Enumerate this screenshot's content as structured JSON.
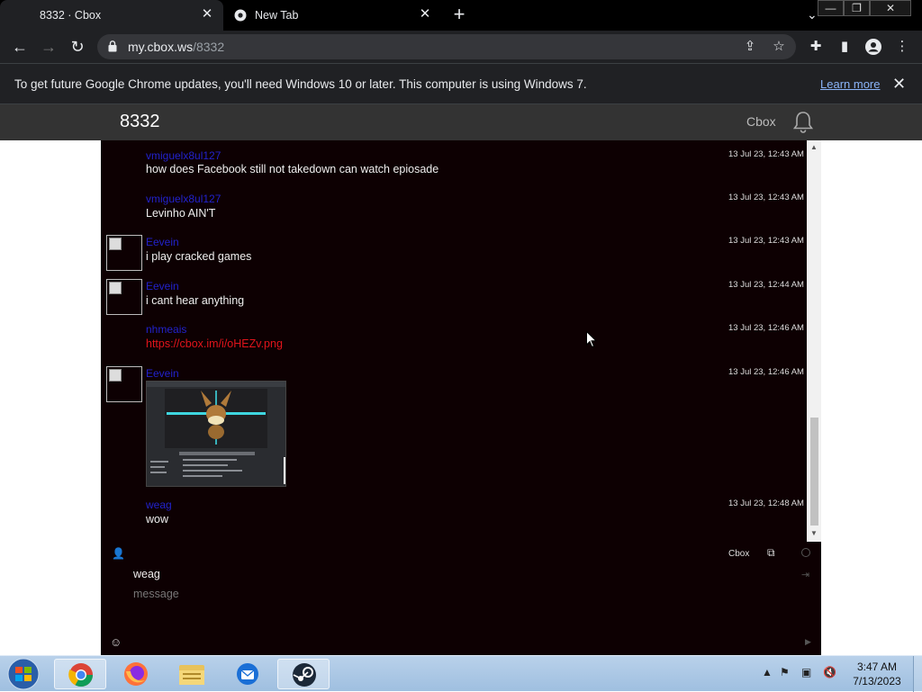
{
  "browser": {
    "tabs": [
      {
        "label": "8332 · Cbox",
        "close": "✕"
      },
      {
        "label": "New Tab",
        "close": "✕"
      }
    ],
    "new_tab": "+",
    "tab_menu": "⌄",
    "window_buttons": {
      "minimize": "—",
      "restore": "❐",
      "close": "✕"
    },
    "url_host": "my.cbox.ws",
    "url_path": "/8332",
    "infobar": {
      "message": "To get future Google Chrome updates, you'll need Windows 10 or later. This computer is using Windows 7.",
      "link": "Learn more",
      "close": "✕"
    }
  },
  "cbox": {
    "title": "8332",
    "brand": "Cbox",
    "messages": [
      {
        "user": "vmiguelx8ul127",
        "text": "how does Facebook still not takedown can watch epiosade",
        "time": "13 Jul 23, 12:43 AM",
        "avatar": false
      },
      {
        "user": "vmiguelx8ul127",
        "text": "Levinho AIN'T",
        "time": "13 Jul 23, 12:43 AM",
        "avatar": false
      },
      {
        "user": "Eevein",
        "text": "i play cracked games",
        "time": "13 Jul 23, 12:43 AM",
        "avatar": true
      },
      {
        "user": "Eevein",
        "text": "i cant hear anything",
        "time": "13 Jul 23, 12:44 AM",
        "avatar": true
      },
      {
        "user": "nhmeais",
        "link": "https://cbox.im/i/oHEZv.png",
        "time": "13 Jul 23, 12:46 AM",
        "avatar": false
      },
      {
        "user": "Eevein",
        "image": true,
        "time": "13 Jul 23, 12:46 AM",
        "avatar": true
      },
      {
        "user": "weag",
        "text": "wow",
        "time": "13 Jul 23, 12:48 AM",
        "avatar": false
      }
    ],
    "composer": {
      "brand": "Cbox",
      "name": "weag",
      "placeholder": "message"
    }
  },
  "taskbar": {
    "time": "3:47 AM",
    "date": "7/13/2023",
    "apps": [
      "start-orb",
      "chrome",
      "firefox",
      "explorer",
      "thunderbird",
      "steam"
    ]
  }
}
